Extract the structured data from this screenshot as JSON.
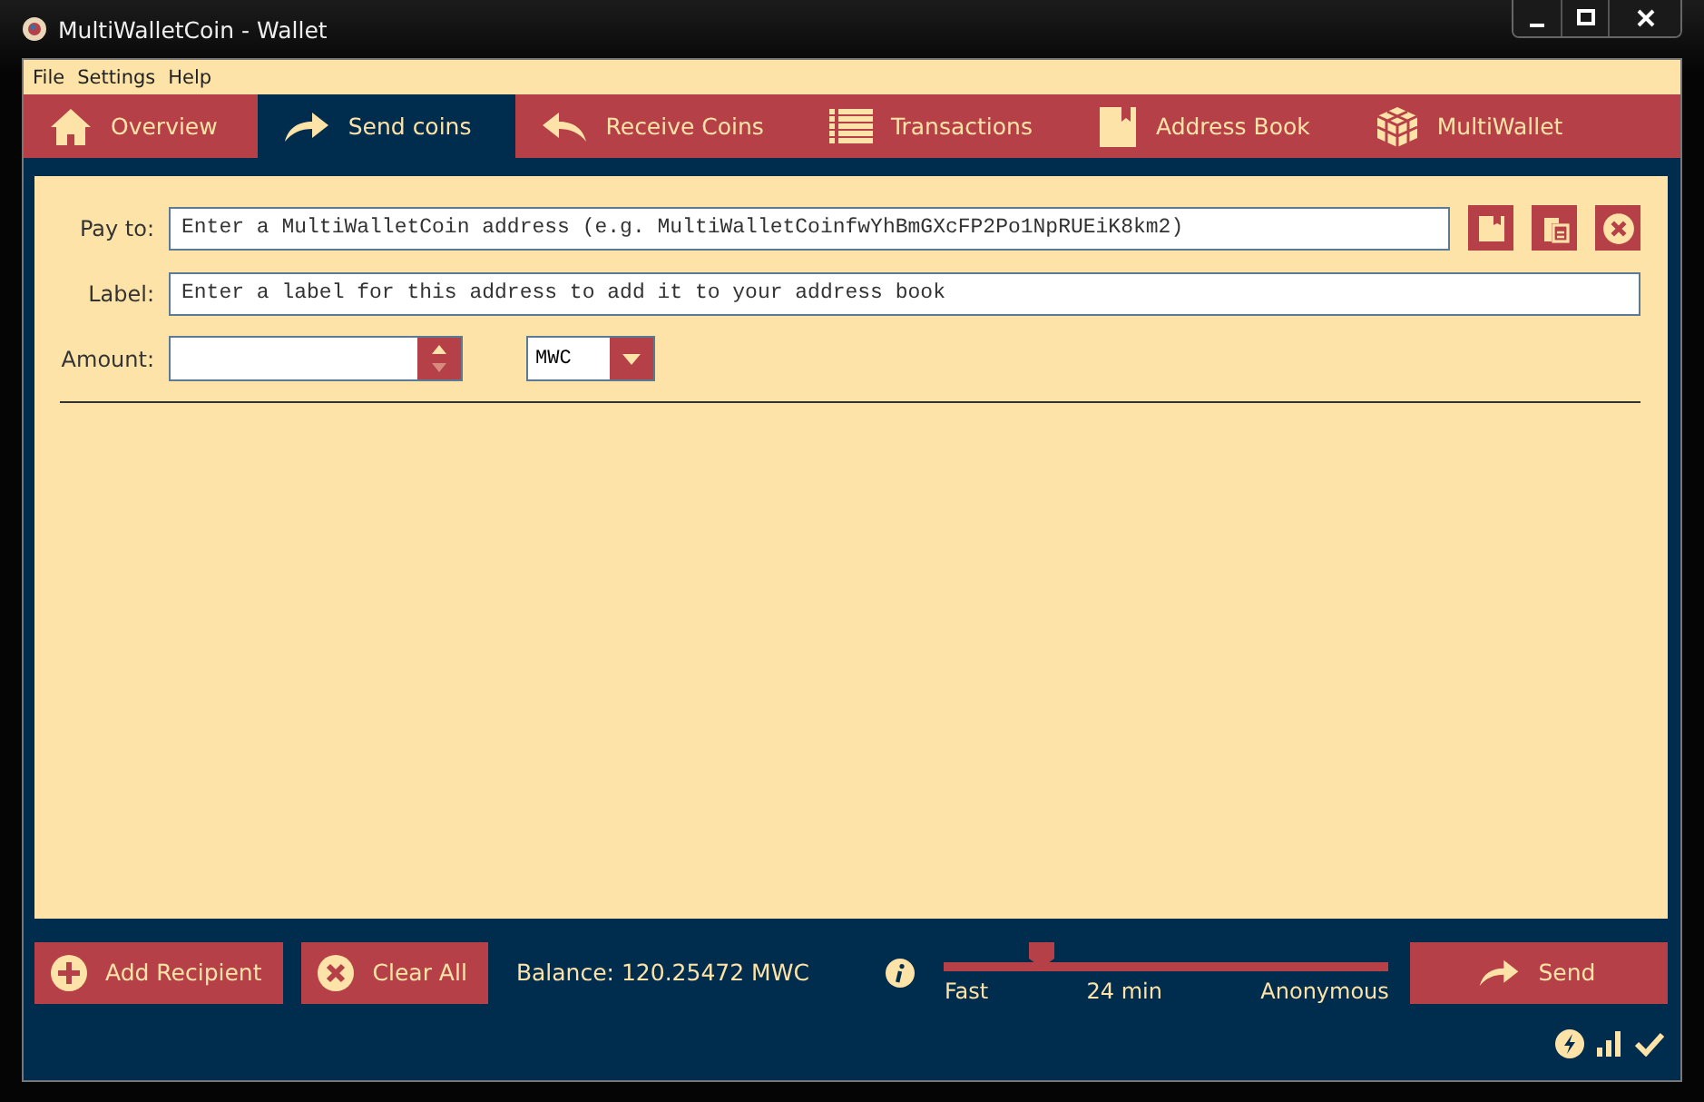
{
  "window": {
    "title": "MultiWalletCoin - Wallet"
  },
  "menu": [
    "File",
    "Settings",
    "Help"
  ],
  "tabs": [
    {
      "label": "Overview",
      "selected": false
    },
    {
      "label": "Send coins",
      "selected": true
    },
    {
      "label": "Receive Coins",
      "selected": false
    },
    {
      "label": "Transactions",
      "selected": false
    },
    {
      "label": "Address Book",
      "selected": false
    },
    {
      "label": "MultiWallet",
      "selected": false
    }
  ],
  "form": {
    "pay_to": {
      "label": "Pay to:",
      "placeholder": "Enter a MultiWalletCoin address (e.g. MultiWalletCoinfwYhBmGXcFP2Po1NpRUEiK8km2)"
    },
    "label": {
      "label": "Label:",
      "placeholder": "Enter a label for this address to add it to your address book"
    },
    "amount": {
      "label": "Amount:",
      "unit": "MWC"
    }
  },
  "footer": {
    "add_recipient": "Add Recipient",
    "clear_all": "Clear All",
    "balance": "Balance: 120.25472 MWC",
    "fee_slider": {
      "level": 0.22,
      "left": "Fast",
      "middle": "24 min",
      "right": "Anonymous"
    },
    "send": "Send"
  }
}
